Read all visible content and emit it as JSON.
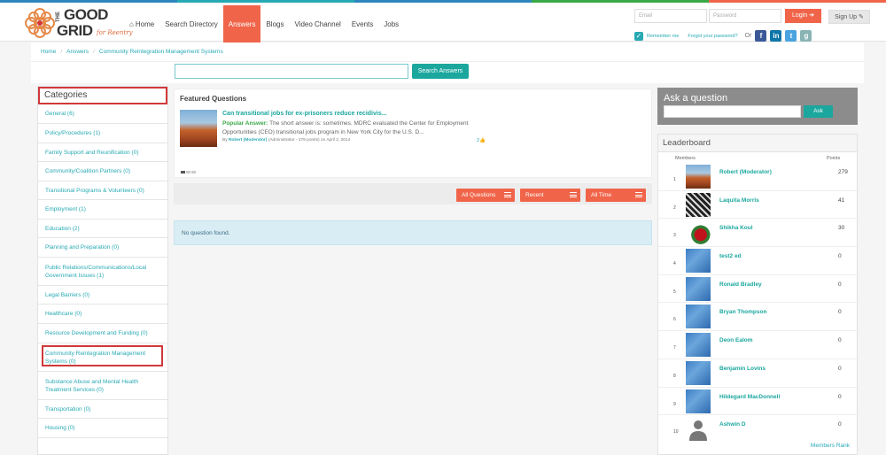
{
  "colors": {
    "accent": "#f0654a",
    "teal": "#1ba79e",
    "link": "#27a9b3",
    "highlight": "#d0393b"
  },
  "logo": {
    "the": "THE",
    "good": "GOOD",
    "grid": "GRID",
    "tagline": "for Reentry"
  },
  "nav": {
    "items": [
      {
        "label": "Home",
        "icon": "home-icon",
        "active": false
      },
      {
        "label": "Search Directory",
        "active": false
      },
      {
        "label": "Answers",
        "active": true
      },
      {
        "label": "Blogs",
        "active": false
      },
      {
        "label": "Video Channel",
        "active": false
      },
      {
        "label": "Events",
        "active": false
      },
      {
        "label": "Jobs",
        "active": false
      }
    ]
  },
  "login": {
    "email_placeholder": "Email",
    "password_placeholder": "Password",
    "login_label": "Login",
    "signup_label": "Sign Up",
    "remember_label": "Remember me",
    "forgot_label": "Forgot your password?",
    "or_label": "Or"
  },
  "breadcrumb": [
    "Home",
    "Answers",
    "Community Reintegration Management Systems"
  ],
  "search": {
    "button_label": "Search Answers",
    "value": ""
  },
  "categories": {
    "title": "Categories",
    "items": [
      "General (6)",
      "Policy/Procedures (1)",
      "Family Support and Reunification (0)",
      "Community/Coalition Partners (0)",
      "Transitional Programs & Volunteers (0)",
      "Employment (1)",
      "Education (2)",
      "Planning and Preparation (0)",
      "Public Relations/Communications/Local Government Issues (1)",
      "Legal Barriers (0)",
      "Healthcare (0)",
      "Resource Development and Funding (0)",
      "Community Reintegration Management Systems (0)",
      "Substance Abuse and Mental Health Treatment Services (0)",
      "Transportation (0)",
      "Housing (0)"
    ]
  },
  "featured": {
    "title": "Featured Questions",
    "question": "Can transitional jobs for ex-prisoners reduce recidivis...",
    "answer_label": "Popular Answer:",
    "answer_text": "The short answer is: sometimes. MDRC evaluated the Center for Employment Opportunities (CEO) transitional jobs program in New York City for the U.S. D...",
    "meta_by": "By",
    "meta_author": "Robert (Moderator)",
    "meta_rest": "(Administrator - 279 points)  on April 2, 2014",
    "count": "2"
  },
  "filters": {
    "all_questions": "All Questions",
    "recent": "Recent",
    "all_time": "All Time"
  },
  "no_question": "No question found.",
  "ask": {
    "title": "Ask a question",
    "button_label": "Ask"
  },
  "leaderboard": {
    "title": "Leaderboard",
    "members_label": "Members",
    "points_label": "Points",
    "rows": [
      {
        "rank": "1",
        "name": "Robert (Moderator)",
        "points": "279"
      },
      {
        "rank": "2",
        "name": "Laquita Morris",
        "points": "41"
      },
      {
        "rank": "3",
        "name": "Shikha Koul",
        "points": "30"
      },
      {
        "rank": "4",
        "name": "test2 ed",
        "points": "0"
      },
      {
        "rank": "5",
        "name": "Ronald Bradley",
        "points": "0"
      },
      {
        "rank": "6",
        "name": "Bryan Thompson",
        "points": "0"
      },
      {
        "rank": "7",
        "name": "Deon Ealom",
        "points": "0"
      },
      {
        "rank": "8",
        "name": "Benjamin Lovins",
        "points": "0"
      },
      {
        "rank": "9",
        "name": "Hildegard MacDonnell",
        "points": "0"
      },
      {
        "rank": "10",
        "name": "Ashwin D",
        "points": "0"
      }
    ],
    "rank_link": "Members Rank"
  }
}
